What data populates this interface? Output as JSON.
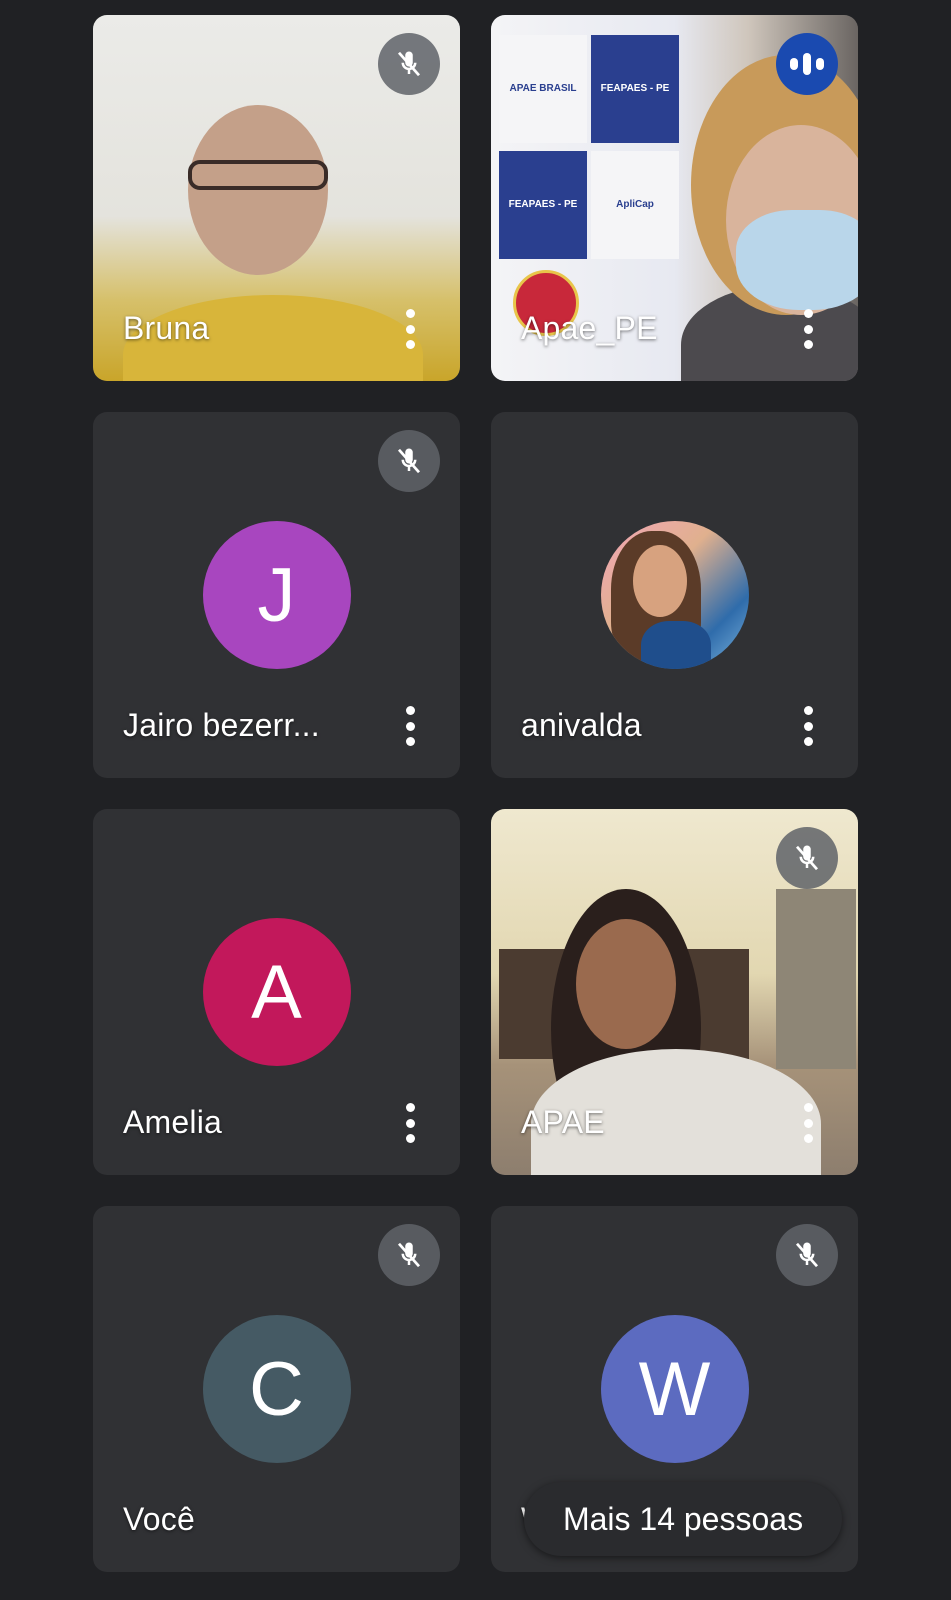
{
  "participants": [
    {
      "name": "Bruna",
      "type": "video",
      "mic": "muted"
    },
    {
      "name": "Apae_PE",
      "type": "video",
      "mic": "speaking"
    },
    {
      "name": "Jairo bezerr...",
      "type": "initial",
      "initial": "J",
      "avatar_color": "#a846bf",
      "mic": "muted"
    },
    {
      "name": "anivalda",
      "type": "photo",
      "mic": "on"
    },
    {
      "name": "Amelia",
      "type": "initial",
      "initial": "A",
      "avatar_color": "#c2185b",
      "mic": "on"
    },
    {
      "name": "APAE",
      "type": "video",
      "mic": "muted"
    },
    {
      "name": "Você",
      "type": "initial",
      "initial": "C",
      "avatar_color": "#455a64",
      "mic": "muted"
    },
    {
      "name": "W",
      "type": "initial",
      "initial": "W",
      "avatar_color": "#5c6bc0",
      "mic": "muted"
    }
  ],
  "banner_logos": [
    "APAE BRASIL",
    "FEAPAES - PE",
    "FEAPAES - PE",
    "ApliCap"
  ],
  "more_people_label": "Mais 14 pessoas",
  "colors": {
    "background": "#202124",
    "tile": "#303134",
    "speaking_badge": "#1a4ab0"
  }
}
